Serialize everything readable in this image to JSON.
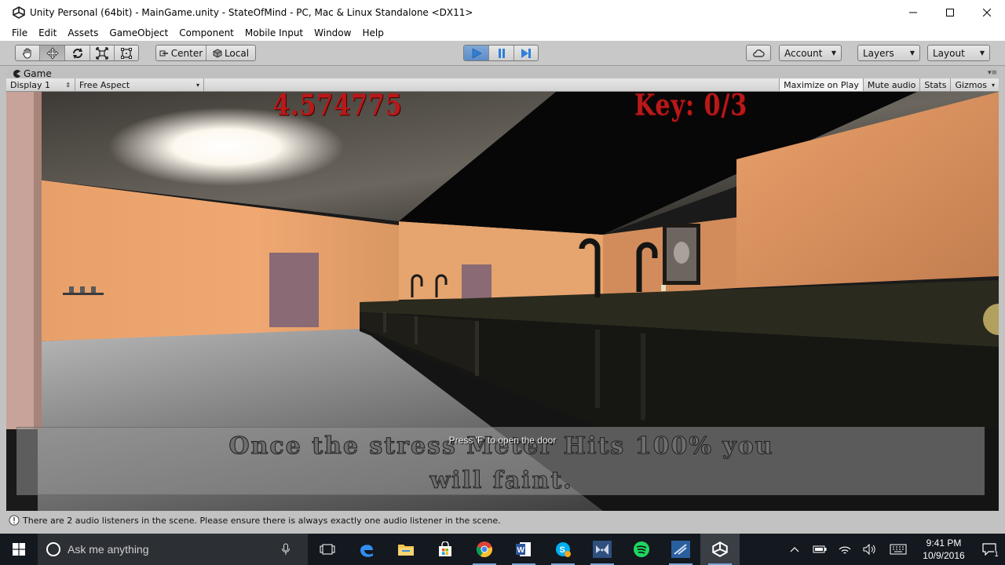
{
  "window": {
    "title": "Unity Personal (64bit) - MainGame.unity - StateOfMind - PC, Mac & Linux Standalone <DX11>"
  },
  "menu": [
    "File",
    "Edit",
    "Assets",
    "GameObject",
    "Component",
    "Mobile Input",
    "Window",
    "Help"
  ],
  "toolbar": {
    "pivot_label": "Center",
    "space_label": "Local",
    "account_label": "Account",
    "layers_label": "Layers",
    "layout_label": "Layout"
  },
  "game_view": {
    "tab_label": "Game",
    "display_label": "Display 1",
    "aspect_label": "Free Aspect",
    "maximize_label": "Maximize on Play",
    "mute_label": "Mute audio",
    "stats_label": "Stats",
    "gizmos_label": "Gizmos"
  },
  "hud": {
    "timer": "4.574775",
    "keys": "Key: 0/3",
    "message_line1": "Once the stress Meter Hits 100% you",
    "message_line2": "will faint.",
    "prompt": "Press 'F' to open the door"
  },
  "status": {
    "message": "There are 2 audio listeners in the scene. Please ensure there is always exactly one audio listener in the scene."
  },
  "taskbar": {
    "search_placeholder": "Ask me anything",
    "time": "9:41 PM",
    "date": "10/9/2016",
    "notification_count": "1"
  },
  "colors": {
    "hud_red": "#b81919",
    "play_blue": "#2f7fd8",
    "taskbar": "#14181f"
  }
}
